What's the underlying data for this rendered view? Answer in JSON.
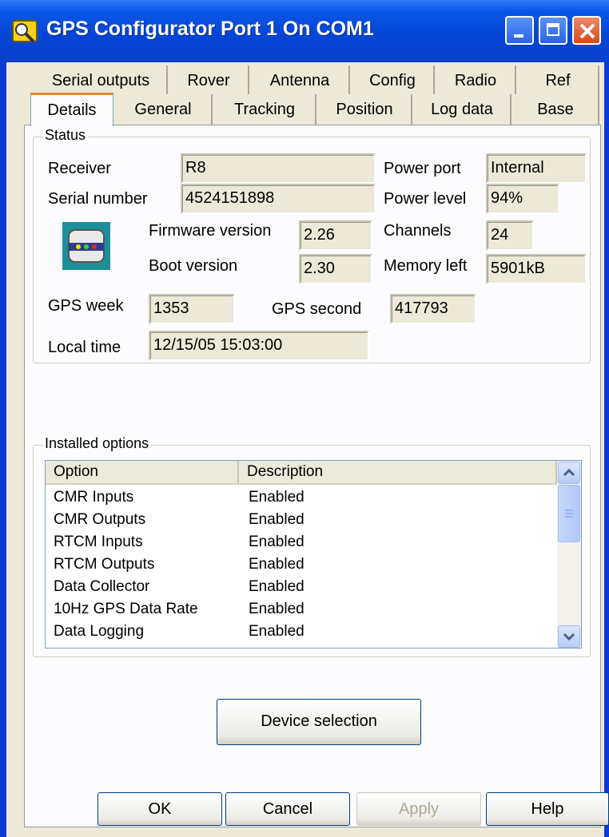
{
  "window": {
    "title": "GPS Configurator Port 1 On COM1"
  },
  "tabs": {
    "row1": [
      "Serial outputs",
      "Rover",
      "Antenna",
      "Config",
      "Radio",
      "Ref"
    ],
    "row2": [
      "Details",
      "General",
      "Tracking",
      "Position",
      "Log data",
      "Base"
    ],
    "active": "Details"
  },
  "status": {
    "group_label": "Status",
    "receiver_label": "Receiver",
    "receiver_value": "R8",
    "serial_label": "Serial number",
    "serial_value": "4524151898",
    "firmware_label": "Firmware version",
    "firmware_value": "2.26",
    "boot_label": "Boot version",
    "boot_value": "2.30",
    "power_port_label": "Power port",
    "power_port_value": "Internal",
    "power_level_label": "Power level",
    "power_level_value": "94%",
    "channels_label": "Channels",
    "channels_value": "24",
    "memory_label": "Memory left",
    "memory_value": "5901kB",
    "gps_week_label": "GPS week",
    "gps_week_value": "1353",
    "gps_second_label": "GPS second",
    "gps_second_value": "417793",
    "local_time_label": "Local time",
    "local_time_value": "12/15/05 15:03:00"
  },
  "options": {
    "group_label": "Installed options",
    "columns": [
      "Option",
      "Description"
    ],
    "rows": [
      {
        "option": "CMR Inputs",
        "description": "Enabled"
      },
      {
        "option": "CMR Outputs",
        "description": "Enabled"
      },
      {
        "option": "RTCM Inputs",
        "description": "Enabled"
      },
      {
        "option": "RTCM Outputs",
        "description": "Enabled"
      },
      {
        "option": "Data Collector",
        "description": "Enabled"
      },
      {
        "option": "10Hz GPS Data Rate",
        "description": "Enabled"
      },
      {
        "option": "Data Logging",
        "description": "Enabled"
      }
    ]
  },
  "buttons": {
    "device_selection": "Device selection",
    "ok": "OK",
    "cancel": "Cancel",
    "apply": "Apply",
    "help": "Help"
  },
  "colors": {
    "titlebar": "#0546d6",
    "face": "#ece9d8",
    "panel": "#fcfcfe",
    "active_tab_accent": "#e68b2c"
  }
}
